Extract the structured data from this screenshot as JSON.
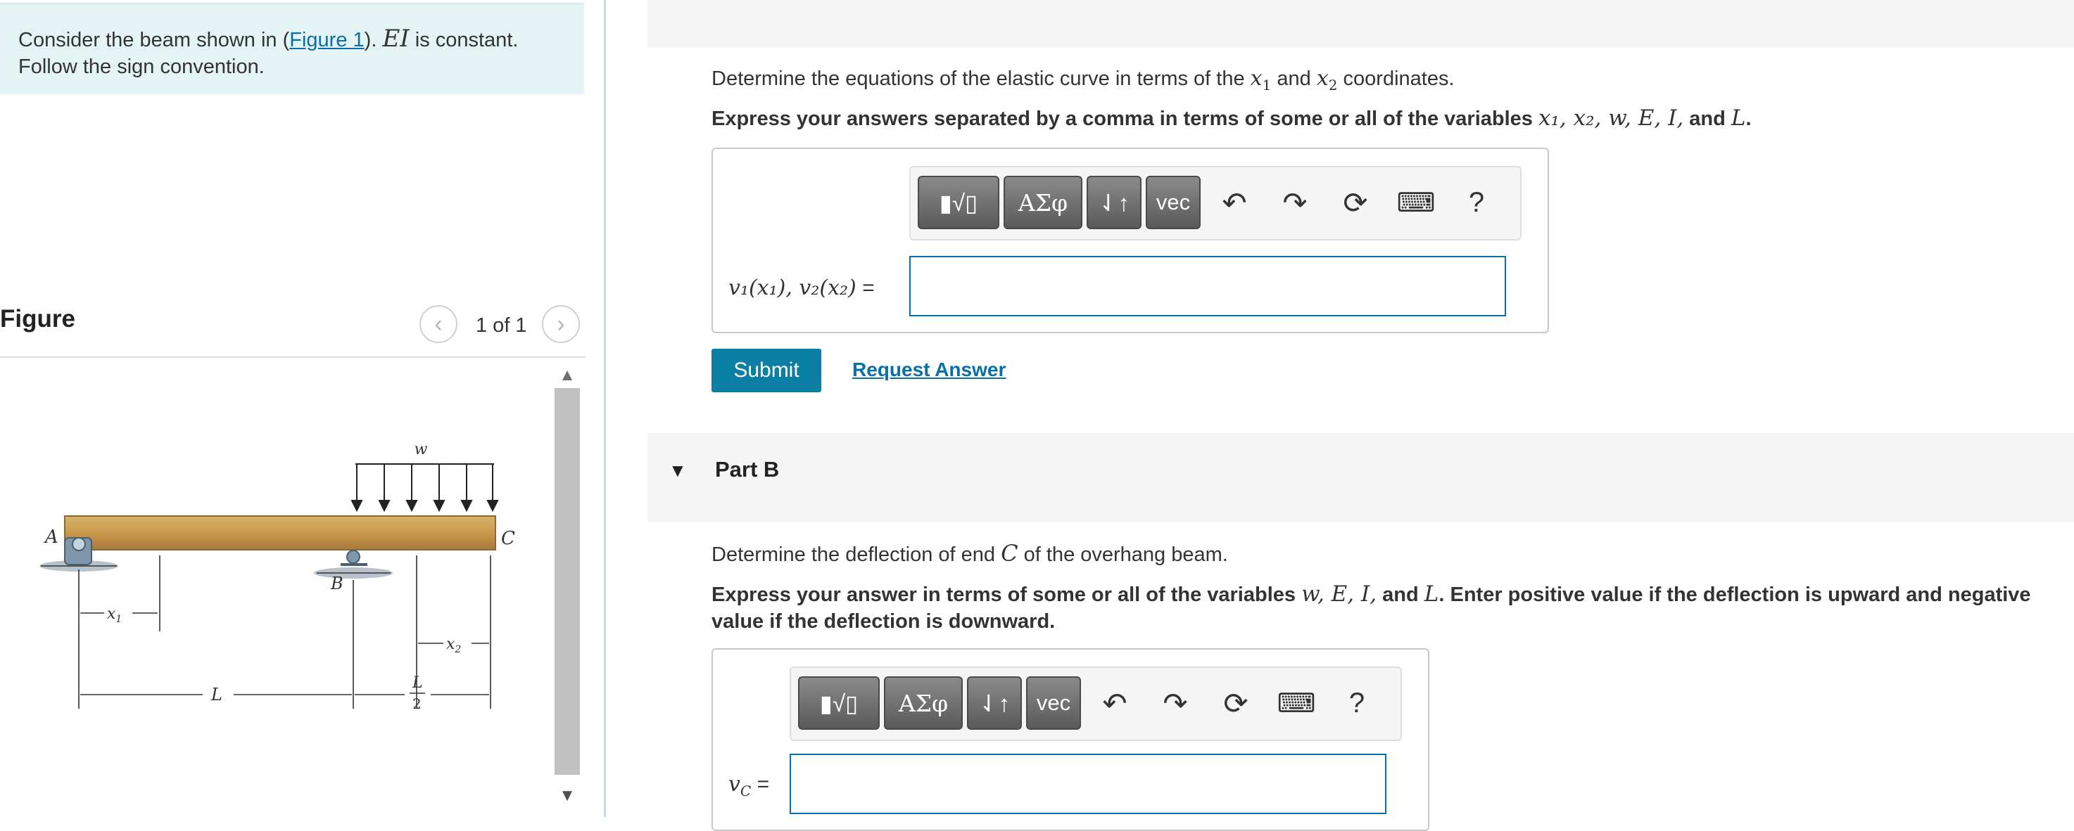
{
  "intro": {
    "text_before": "Consider the beam shown in (",
    "figure_link": "Figure 1",
    "text_after": "). ",
    "ei": "EI",
    "text_const": " is constant.",
    "line2": "Follow the sign convention."
  },
  "figure": {
    "title": "Figure",
    "counter": "1 of 1",
    "labels": {
      "w": "w",
      "A": "A",
      "B": "B",
      "C": "C",
      "x1": "x",
      "x1_sub": "1",
      "x2": "x",
      "x2_sub": "2",
      "L": "L",
      "L_num": "L",
      "L_den": "2"
    }
  },
  "part_a": {
    "prompt_pre": "Determine the equations of the elastic curve in terms of the ",
    "x1": "x",
    "x1_sub": "1",
    "and": " and ",
    "x2": "x",
    "x2_sub": "2",
    "prompt_post": " coordinates.",
    "express_pre": "Express your answers separated by a comma in terms of some or all of the variables ",
    "vars": "x₁, x₂, w, E, I,",
    "and_word": " and ",
    "last_var": "L",
    "period": ".",
    "answer_label": "v₁(x₁), v₂(x₂)",
    "equals": "=",
    "submit_label": "Submit",
    "request_answer_label": "Request Answer"
  },
  "toolbar": {
    "templates_label": "▮√▯",
    "greek_label": "ΑΣφ",
    "arrows_label": "⇃↑",
    "vec_label": "vec",
    "help_label": "?"
  },
  "part_b": {
    "title": "Part B",
    "prompt_pre": "Determine the deflection of end ",
    "c_var": "C",
    "prompt_post": " of the overhang beam.",
    "express_pre": "Express your answer in terms of some or all of the variables ",
    "vars": "w, E, I,",
    "and_word": " and ",
    "last_var": "L",
    "express_post": ". Enter positive value if the deflection is upward and negative",
    "express_line2": "value if the deflection is downward.",
    "answer_label": "v",
    "answer_sub": "C",
    "equals": "="
  }
}
